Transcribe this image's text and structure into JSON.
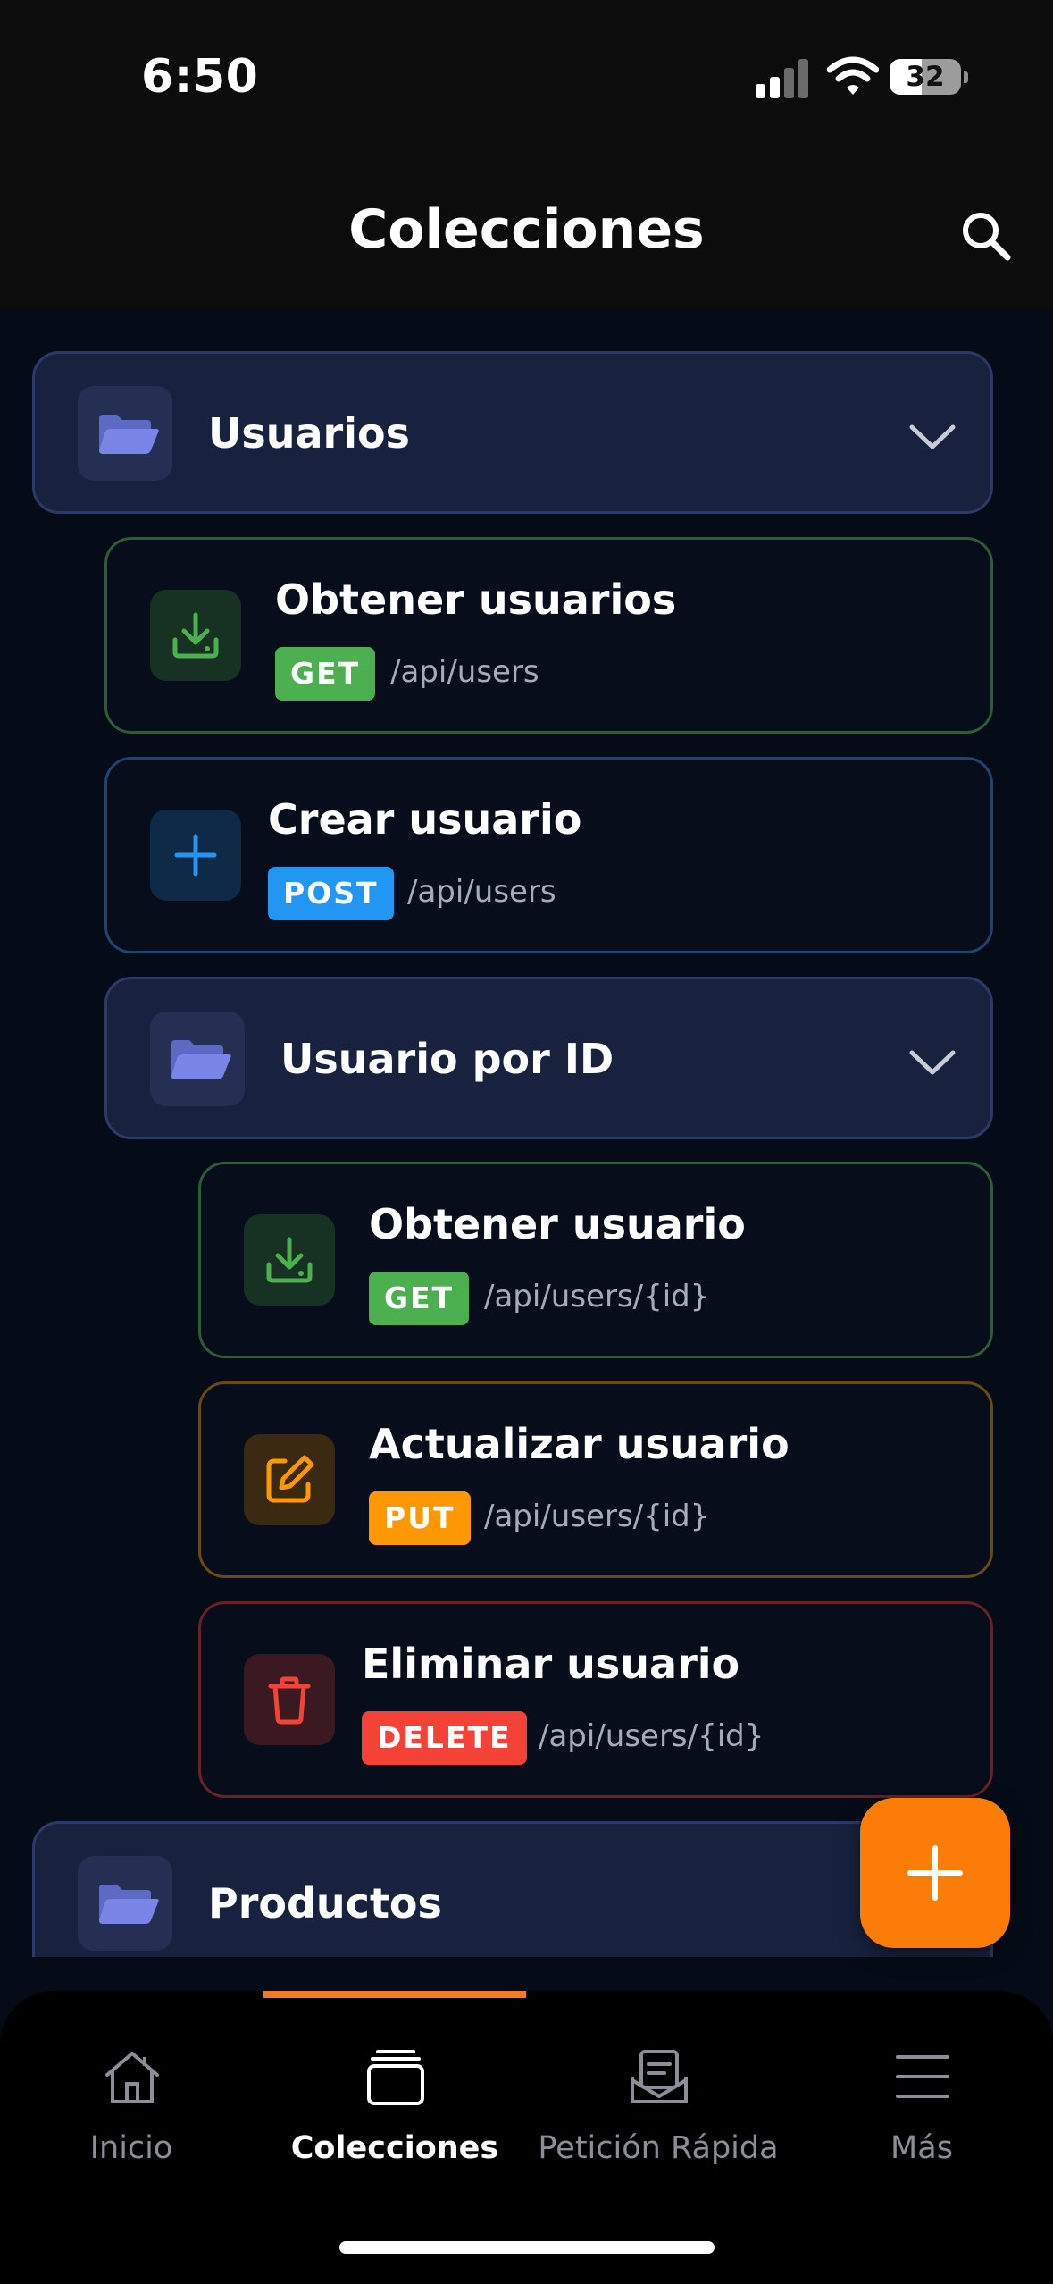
{
  "status_bar": {
    "time": "6:50",
    "battery": "32"
  },
  "header": {
    "title": "Colecciones",
    "search_icon": "search-icon"
  },
  "colors": {
    "background": "#050c17",
    "folder_bg": "#18223f",
    "get": "#4caf50",
    "post": "#2196f3",
    "put": "#ff9800",
    "delete": "#f44336",
    "accent": "#fb7d08"
  },
  "collections": [
    {
      "title": "Usuarios",
      "expanded": true,
      "requests": [
        {
          "title": "Obtener usuarios",
          "method": "GET",
          "endpoint": "/api/users",
          "icon": "download-icon"
        },
        {
          "title": "Crear usuario",
          "method": "POST",
          "endpoint": "/api/users",
          "icon": "plus-icon"
        }
      ],
      "subfolder": {
        "title": "Usuario por ID",
        "expanded": true,
        "requests": [
          {
            "title": "Obtener usuario",
            "method": "GET",
            "endpoint": "/api/users/{id}",
            "icon": "download-icon"
          },
          {
            "title": "Actualizar usuario",
            "method": "PUT",
            "endpoint": "/api/users/{id}",
            "icon": "edit-icon"
          },
          {
            "title": "Eliminar usuario",
            "method": "DELETE",
            "endpoint": "/api/users/{id}",
            "icon": "trash-icon"
          }
        ]
      }
    },
    {
      "title": "Productos",
      "expanded": false
    }
  ],
  "fab": {
    "icon": "plus-icon"
  },
  "tabs": [
    {
      "label": "Inicio",
      "icon": "home-icon",
      "active": false
    },
    {
      "label": "Colecciones",
      "icon": "collections-icon",
      "active": true
    },
    {
      "label": "Petición Rápida",
      "icon": "quick-request-icon",
      "active": false
    },
    {
      "label": "Más",
      "icon": "menu-icon",
      "active": false
    }
  ]
}
